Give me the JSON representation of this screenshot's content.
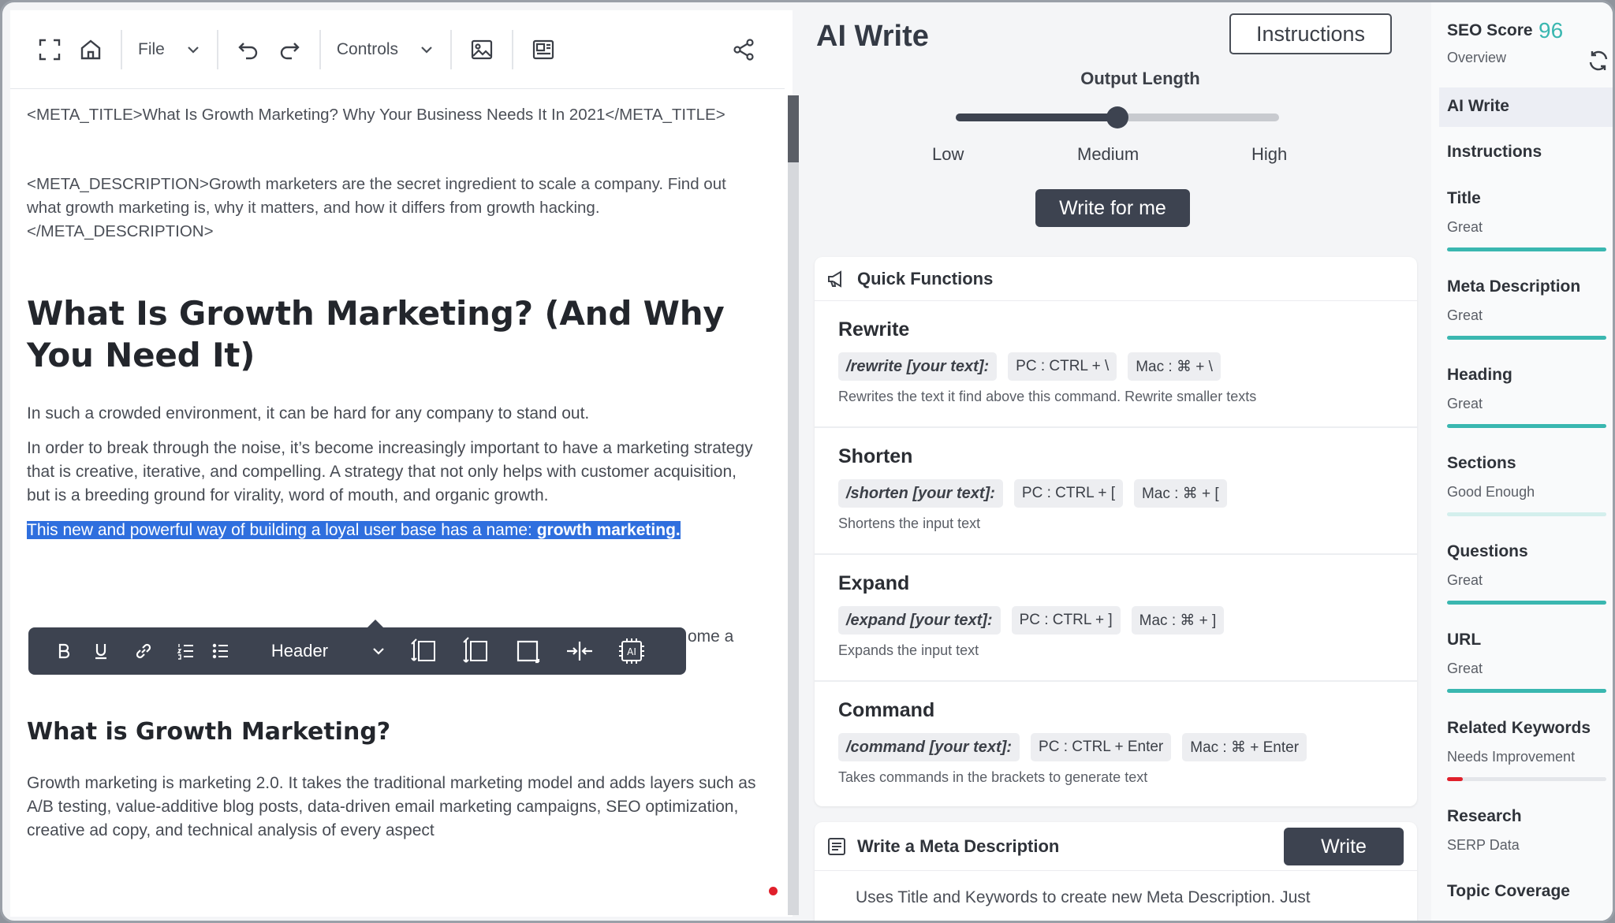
{
  "editor": {
    "toolbar": {
      "file_label": "File",
      "controls_label": "Controls"
    },
    "meta_title": "<META_TITLE>What Is Growth Marketing? Why Your Business Needs It In 2021</META_TITLE>",
    "meta_description": "<META_DESCRIPTION>Growth marketers are the secret ingredient to scale a company. Find out what growth marketing is, why it matters, and how it differs from growth hacking.</META_DESCRIPTION>",
    "heading1": "What Is Growth Marketing? (And Why You Need It)",
    "paragraph1": "In such a crowded environment, it can be hard for any company to stand out.",
    "paragraph2": "In order to break through the noise, it’s become increasingly important to have a marketing strategy that is creative, iterative, and compelling. A strategy that not only helps with customer acquisition, but is a breeding ground for virality, word of mouth, and organic growth.",
    "selected_text": "This new and powerful way of building a loyal user base has a name: ",
    "selected_bold": "growth marketing.",
    "hidden_fragment": "ome a",
    "heading2": "What is Growth Marketing?",
    "paragraph3": "Growth marketing is marketing 2.0. It takes the traditional marketing model and adds layers such as A/B testing, value-additive blog posts, data-driven email marketing campaigns, SEO optimization, creative ad copy, and technical analysis of every aspect",
    "floating_toolbar": {
      "header_label": "Header"
    }
  },
  "ai_write": {
    "title": "AI Write",
    "instructions_button": "Instructions",
    "output_length_label": "Output Length",
    "slider": {
      "low": "Low",
      "medium": "Medium",
      "high": "High",
      "value": 0.5
    },
    "write_button": "Write for me",
    "quick_functions_title": "Quick Functions",
    "functions": [
      {
        "name": "Rewrite",
        "command": "/rewrite [your text]:",
        "pc": "PC : CTRL + \\",
        "mac": "Mac : ⌘ + \\",
        "desc": "Rewrites the text it find above this command. Rewrite smaller texts"
      },
      {
        "name": "Shorten",
        "command": "/shorten [your text]:",
        "pc": "PC : CTRL + [",
        "mac": "Mac : ⌘ + [",
        "desc": "Shortens the input text"
      },
      {
        "name": "Expand",
        "command": "/expand [your text]:",
        "pc": "PC : CTRL + ]",
        "mac": "Mac : ⌘ + ]",
        "desc": "Expands the input text"
      },
      {
        "name": "Command",
        "command": "/command [your text]:",
        "pc": "PC : CTRL + Enter",
        "mac": "Mac : ⌘ + Enter",
        "desc": "Takes commands in the brackets to generate text"
      }
    ],
    "meta_card": {
      "title": "Write a Meta Description",
      "button": "Write",
      "desc": "Uses Title and Keywords to create new Meta Description. Just"
    }
  },
  "seo": {
    "score_label": "SEO Score",
    "score": "96",
    "overview": "Overview",
    "items": [
      {
        "label": "AI Write"
      },
      {
        "label": "Instructions"
      },
      {
        "label": "Title",
        "status": "Great",
        "level": 1.0
      },
      {
        "label": "Meta Description",
        "status": "Great",
        "level": 1.0
      },
      {
        "label": "Heading",
        "status": "Great",
        "level": 1.0
      },
      {
        "label": "Sections",
        "status": "Good Enough",
        "level": 1.0
      },
      {
        "label": "Questions",
        "status": "Great",
        "level": 1.0
      },
      {
        "label": "URL",
        "status": "Great",
        "level": 1.0
      },
      {
        "label": "Related Keywords",
        "status": "Needs Improvement",
        "level": 0.1
      },
      {
        "label": "Research",
        "status": "SERP Data"
      },
      {
        "label": "Topic Coverage"
      }
    ]
  },
  "colors": {
    "accent": "#3d4350",
    "teal": "#3ab7b0",
    "selection": "#2f6fde",
    "alert": "#e0202b"
  }
}
